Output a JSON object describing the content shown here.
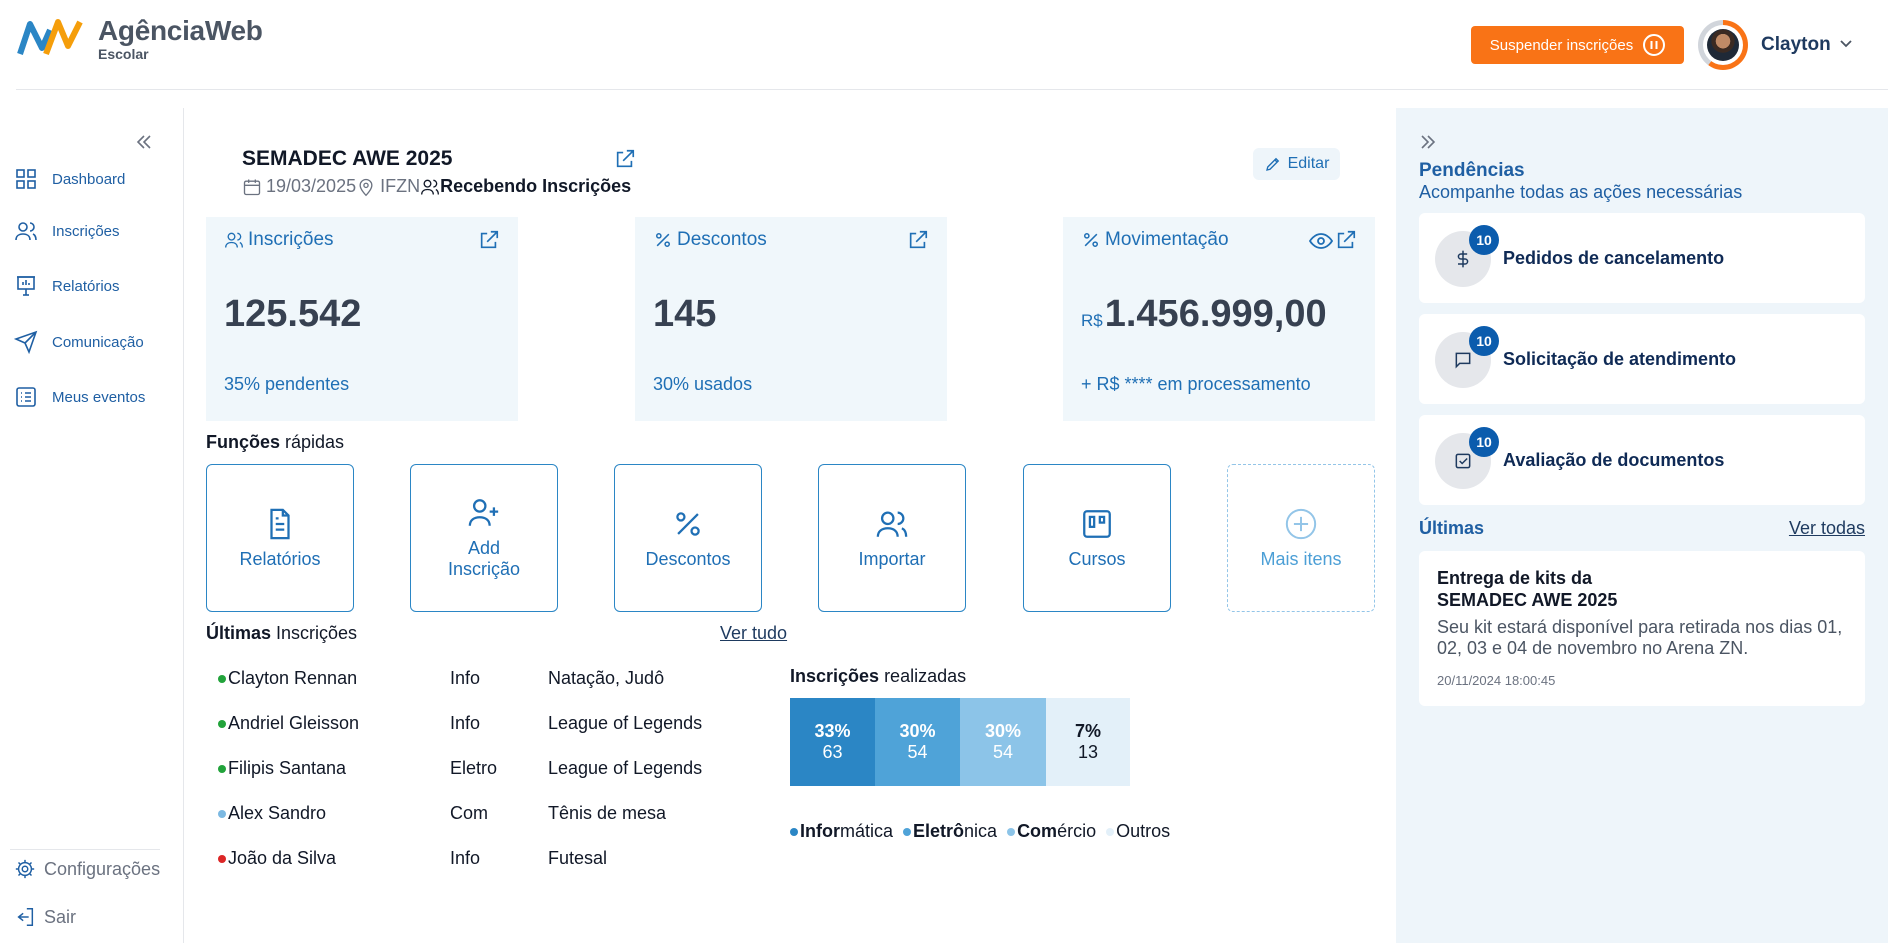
{
  "header": {
    "logo_name": "AgênciaWeb",
    "logo_sub": "Escolar",
    "suspend_label": "Suspender inscrições",
    "user_name": "Clayton",
    "accent": "#f97316"
  },
  "sidebar": {
    "items": [
      {
        "label": "Dashboard",
        "icon": "grid-icon"
      },
      {
        "label": "Inscrições",
        "icon": "users-icon"
      },
      {
        "label": "Relatórios",
        "icon": "presentation-icon"
      },
      {
        "label": "Comunicação",
        "icon": "send-icon"
      },
      {
        "label": "Meus eventos",
        "icon": "list-icon"
      }
    ],
    "settings_label": "Configurações",
    "logout_label": "Sair"
  },
  "event": {
    "title": "SEMADEC AWE 2025",
    "date": "19/03/2025",
    "location": "IFZN",
    "status": "Recebendo Inscrições",
    "edit_label": "Editar"
  },
  "stats": {
    "inscricoes": {
      "label": "Inscrições",
      "value": "125.542",
      "sub": "35% pendentes"
    },
    "descontos": {
      "label": "Descontos",
      "value": "145",
      "sub": "30% usados"
    },
    "movimentacao": {
      "label": "Movimentação",
      "currency": "R$",
      "value": "1.456.999,00",
      "sub": "+ R$ **** em processamento"
    }
  },
  "quick": {
    "title_bold": "Funções",
    "title_rest": " rápidas",
    "items": [
      {
        "label": "Relatórios",
        "icon": "file-icon"
      },
      {
        "label": "Add Inscrição",
        "icon": "user-plus-icon"
      },
      {
        "label": "Descontos",
        "icon": "percent-icon"
      },
      {
        "label": "Importar",
        "icon": "users-icon"
      },
      {
        "label": "Cursos",
        "icon": "kanban-icon"
      },
      {
        "label": "Mais itens",
        "icon": "plus-circle-icon"
      }
    ]
  },
  "ultimas": {
    "title_bold": "Últimas",
    "title_rest": " Inscrições",
    "ver_tudo": "Ver tudo",
    "rows": [
      {
        "name": "Clayton Rennan",
        "curso": "Info",
        "mod": "Natação, Judô",
        "color": "#22a33b"
      },
      {
        "name": "Andriel Gleisson",
        "curso": "Info",
        "mod": "League of Legends",
        "color": "#22a33b"
      },
      {
        "name": "Filipis Santana",
        "curso": "Eletro",
        "mod": "League of Legends",
        "color": "#22a33b"
      },
      {
        "name": "Alex Sandro",
        "curso": "Com",
        "mod": "Tênis de mesa",
        "color": "#7cb9e2"
      },
      {
        "name": "João da Silva",
        "curso": "Info",
        "mod": "Futesal",
        "color": "#dc2626"
      }
    ]
  },
  "chart_data": {
    "type": "bar",
    "title_bold": "Inscrições",
    "title_rest": " realizadas",
    "segments": [
      {
        "pct": "33%",
        "count": "63",
        "color": "#2b86c5",
        "text": "#ffffff"
      },
      {
        "pct": "30%",
        "count": "54",
        "color": "#4fa3d8",
        "text": "#ffffff"
      },
      {
        "pct": "30%",
        "count": "54",
        "color": "#8cc4e8",
        "text": "#ffffff"
      },
      {
        "pct": "7%",
        "count": "13",
        "color": "#e3f0f9",
        "text": "#111827"
      }
    ],
    "legend": [
      {
        "bold": "Infor",
        "rest": "mática",
        "color": "#2b86c5"
      },
      {
        "bold": "Eletrô",
        "rest": "nica",
        "color": "#4fa3d8"
      },
      {
        "bold": "Com",
        "rest": "ércio",
        "color": "#8cc4e8"
      },
      {
        "bold": "",
        "rest": "Outros",
        "color": "#e3f0f9"
      }
    ]
  },
  "pendencias": {
    "title": "Pendências",
    "subtitle": "Acompanhe todas as ações necessárias",
    "items": [
      {
        "label": "Pedidos de cancelamento",
        "count": "10",
        "icon": "dollar-icon"
      },
      {
        "label": "Solicitação de atendimento",
        "count": "10",
        "icon": "message-icon"
      },
      {
        "label": "Avaliação de documentos",
        "count": "10",
        "icon": "check-square-icon"
      }
    ],
    "ultimas_label": "Últimas",
    "ver_todas": "Ver todas",
    "news": {
      "title": "Entrega de kits da SEMADEC AWE 2025",
      "body": "Seu kit estará disponível para retirada nos dias 01, 02, 03 e 04 de novembro no Arena ZN.",
      "date": "20/11/2024 18:00:45"
    }
  }
}
